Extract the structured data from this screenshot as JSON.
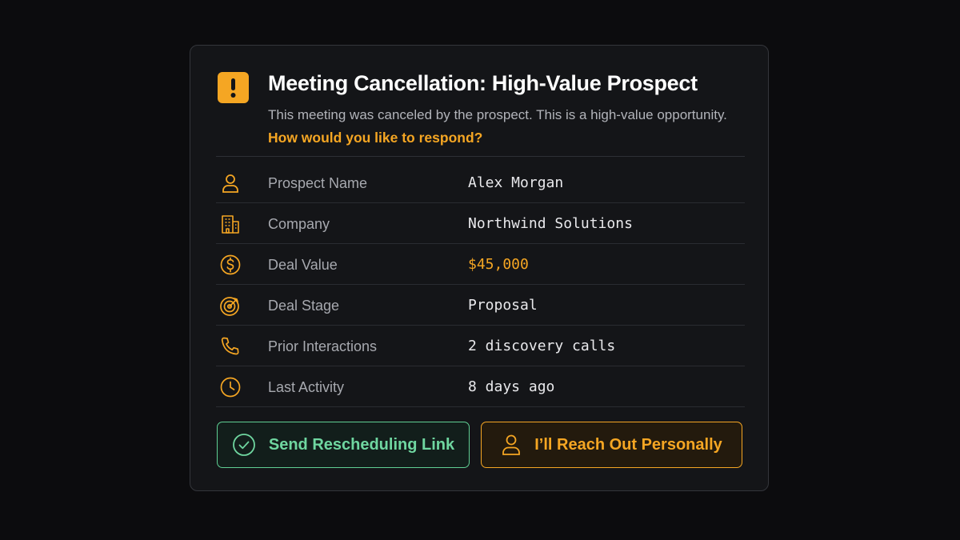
{
  "dialog": {
    "title": "Meeting Cancellation: High-Value Prospect",
    "subtitle": "This meeting was canceled by the prospect. This is a high-value opportunity.",
    "prompt": "How would you like to respond?",
    "alert_icon": "exclamation-icon"
  },
  "details": [
    {
      "icon": "person-icon",
      "label": "Prospect Name",
      "value": "Alex Morgan"
    },
    {
      "icon": "building-icon",
      "label": "Company",
      "value": "Northwind Solutions"
    },
    {
      "icon": "dollar-icon",
      "label": "Deal Value",
      "value": "$45,000"
    },
    {
      "icon": "target-icon",
      "label": "Deal Stage",
      "value": "Proposal"
    },
    {
      "icon": "phone-icon",
      "label": "Prior Interactions",
      "value": "2 discovery calls"
    },
    {
      "icon": "clock-icon",
      "label": "Last Activity",
      "value": "8 days ago"
    }
  ],
  "actions": {
    "reschedule_label": "Send Rescheduling Link",
    "personal_label": "I’ll Reach Out Personally"
  },
  "colors": {
    "accent": "#f5a623",
    "success": "#6fd6a0",
    "background": "#0c0c0e",
    "card": "#141518"
  }
}
